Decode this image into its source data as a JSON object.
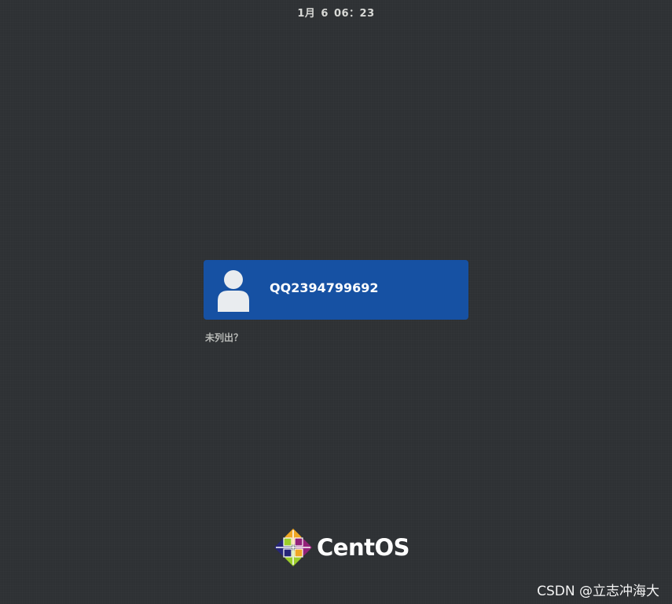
{
  "top_bar": {
    "clock": "1月 6  06：23"
  },
  "login": {
    "user": {
      "name": "QQ2394799692",
      "avatar_icon": "user-avatar-icon"
    },
    "not_listed_label": "未列出？"
  },
  "branding": {
    "logo_icon": "centos-logo-icon",
    "name": "CentOS",
    "colors": {
      "green": "#9ccd2a",
      "purple": "#932279",
      "orange": "#efa724",
      "blue": "#262577"
    }
  },
  "watermark": "CSDN @立志冲海大",
  "theme": {
    "background": "#2e3134",
    "card_bg": "#1651a3"
  }
}
